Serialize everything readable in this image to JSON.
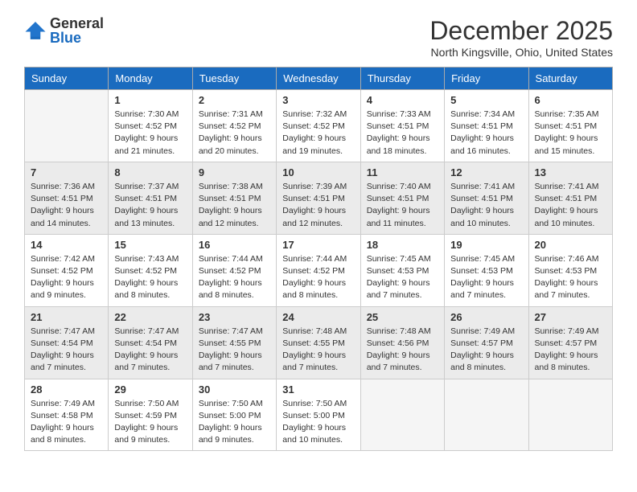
{
  "header": {
    "logo_general": "General",
    "logo_blue": "Blue",
    "month_title": "December 2025",
    "location": "North Kingsville, Ohio, United States"
  },
  "columns": [
    "Sunday",
    "Monday",
    "Tuesday",
    "Wednesday",
    "Thursday",
    "Friday",
    "Saturday"
  ],
  "weeks": [
    {
      "shaded": false,
      "days": [
        {
          "num": "",
          "sunrise": "",
          "sunset": "",
          "daylight": ""
        },
        {
          "num": "1",
          "sunrise": "Sunrise: 7:30 AM",
          "sunset": "Sunset: 4:52 PM",
          "daylight": "Daylight: 9 hours and 21 minutes."
        },
        {
          "num": "2",
          "sunrise": "Sunrise: 7:31 AM",
          "sunset": "Sunset: 4:52 PM",
          "daylight": "Daylight: 9 hours and 20 minutes."
        },
        {
          "num": "3",
          "sunrise": "Sunrise: 7:32 AM",
          "sunset": "Sunset: 4:52 PM",
          "daylight": "Daylight: 9 hours and 19 minutes."
        },
        {
          "num": "4",
          "sunrise": "Sunrise: 7:33 AM",
          "sunset": "Sunset: 4:51 PM",
          "daylight": "Daylight: 9 hours and 18 minutes."
        },
        {
          "num": "5",
          "sunrise": "Sunrise: 7:34 AM",
          "sunset": "Sunset: 4:51 PM",
          "daylight": "Daylight: 9 hours and 16 minutes."
        },
        {
          "num": "6",
          "sunrise": "Sunrise: 7:35 AM",
          "sunset": "Sunset: 4:51 PM",
          "daylight": "Daylight: 9 hours and 15 minutes."
        }
      ]
    },
    {
      "shaded": true,
      "days": [
        {
          "num": "7",
          "sunrise": "Sunrise: 7:36 AM",
          "sunset": "Sunset: 4:51 PM",
          "daylight": "Daylight: 9 hours and 14 minutes."
        },
        {
          "num": "8",
          "sunrise": "Sunrise: 7:37 AM",
          "sunset": "Sunset: 4:51 PM",
          "daylight": "Daylight: 9 hours and 13 minutes."
        },
        {
          "num": "9",
          "sunrise": "Sunrise: 7:38 AM",
          "sunset": "Sunset: 4:51 PM",
          "daylight": "Daylight: 9 hours and 12 minutes."
        },
        {
          "num": "10",
          "sunrise": "Sunrise: 7:39 AM",
          "sunset": "Sunset: 4:51 PM",
          "daylight": "Daylight: 9 hours and 12 minutes."
        },
        {
          "num": "11",
          "sunrise": "Sunrise: 7:40 AM",
          "sunset": "Sunset: 4:51 PM",
          "daylight": "Daylight: 9 hours and 11 minutes."
        },
        {
          "num": "12",
          "sunrise": "Sunrise: 7:41 AM",
          "sunset": "Sunset: 4:51 PM",
          "daylight": "Daylight: 9 hours and 10 minutes."
        },
        {
          "num": "13",
          "sunrise": "Sunrise: 7:41 AM",
          "sunset": "Sunset: 4:51 PM",
          "daylight": "Daylight: 9 hours and 10 minutes."
        }
      ]
    },
    {
      "shaded": false,
      "days": [
        {
          "num": "14",
          "sunrise": "Sunrise: 7:42 AM",
          "sunset": "Sunset: 4:52 PM",
          "daylight": "Daylight: 9 hours and 9 minutes."
        },
        {
          "num": "15",
          "sunrise": "Sunrise: 7:43 AM",
          "sunset": "Sunset: 4:52 PM",
          "daylight": "Daylight: 9 hours and 8 minutes."
        },
        {
          "num": "16",
          "sunrise": "Sunrise: 7:44 AM",
          "sunset": "Sunset: 4:52 PM",
          "daylight": "Daylight: 9 hours and 8 minutes."
        },
        {
          "num": "17",
          "sunrise": "Sunrise: 7:44 AM",
          "sunset": "Sunset: 4:52 PM",
          "daylight": "Daylight: 9 hours and 8 minutes."
        },
        {
          "num": "18",
          "sunrise": "Sunrise: 7:45 AM",
          "sunset": "Sunset: 4:53 PM",
          "daylight": "Daylight: 9 hours and 7 minutes."
        },
        {
          "num": "19",
          "sunrise": "Sunrise: 7:45 AM",
          "sunset": "Sunset: 4:53 PM",
          "daylight": "Daylight: 9 hours and 7 minutes."
        },
        {
          "num": "20",
          "sunrise": "Sunrise: 7:46 AM",
          "sunset": "Sunset: 4:53 PM",
          "daylight": "Daylight: 9 hours and 7 minutes."
        }
      ]
    },
    {
      "shaded": true,
      "days": [
        {
          "num": "21",
          "sunrise": "Sunrise: 7:47 AM",
          "sunset": "Sunset: 4:54 PM",
          "daylight": "Daylight: 9 hours and 7 minutes."
        },
        {
          "num": "22",
          "sunrise": "Sunrise: 7:47 AM",
          "sunset": "Sunset: 4:54 PM",
          "daylight": "Daylight: 9 hours and 7 minutes."
        },
        {
          "num": "23",
          "sunrise": "Sunrise: 7:47 AM",
          "sunset": "Sunset: 4:55 PM",
          "daylight": "Daylight: 9 hours and 7 minutes."
        },
        {
          "num": "24",
          "sunrise": "Sunrise: 7:48 AM",
          "sunset": "Sunset: 4:55 PM",
          "daylight": "Daylight: 9 hours and 7 minutes."
        },
        {
          "num": "25",
          "sunrise": "Sunrise: 7:48 AM",
          "sunset": "Sunset: 4:56 PM",
          "daylight": "Daylight: 9 hours and 7 minutes."
        },
        {
          "num": "26",
          "sunrise": "Sunrise: 7:49 AM",
          "sunset": "Sunset: 4:57 PM",
          "daylight": "Daylight: 9 hours and 8 minutes."
        },
        {
          "num": "27",
          "sunrise": "Sunrise: 7:49 AM",
          "sunset": "Sunset: 4:57 PM",
          "daylight": "Daylight: 9 hours and 8 minutes."
        }
      ]
    },
    {
      "shaded": false,
      "days": [
        {
          "num": "28",
          "sunrise": "Sunrise: 7:49 AM",
          "sunset": "Sunset: 4:58 PM",
          "daylight": "Daylight: 9 hours and 8 minutes."
        },
        {
          "num": "29",
          "sunrise": "Sunrise: 7:50 AM",
          "sunset": "Sunset: 4:59 PM",
          "daylight": "Daylight: 9 hours and 9 minutes."
        },
        {
          "num": "30",
          "sunrise": "Sunrise: 7:50 AM",
          "sunset": "Sunset: 5:00 PM",
          "daylight": "Daylight: 9 hours and 9 minutes."
        },
        {
          "num": "31",
          "sunrise": "Sunrise: 7:50 AM",
          "sunset": "Sunset: 5:00 PM",
          "daylight": "Daylight: 9 hours and 10 minutes."
        },
        {
          "num": "",
          "sunrise": "",
          "sunset": "",
          "daylight": ""
        },
        {
          "num": "",
          "sunrise": "",
          "sunset": "",
          "daylight": ""
        },
        {
          "num": "",
          "sunrise": "",
          "sunset": "",
          "daylight": ""
        }
      ]
    }
  ]
}
